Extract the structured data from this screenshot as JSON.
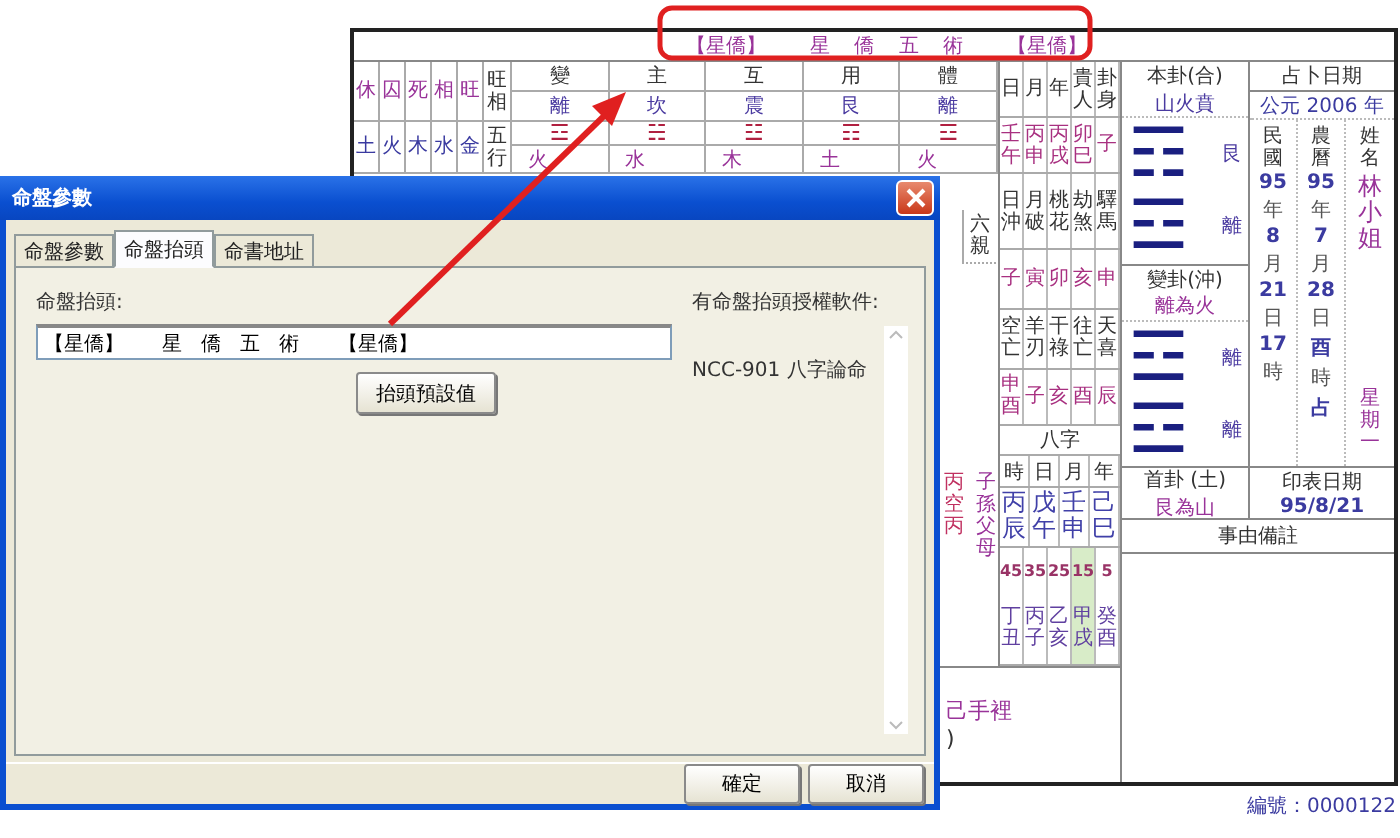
{
  "chart_header": {
    "left_tag": "【星僑】",
    "title": "星 僑 五 術",
    "right_tag": "【星僑】"
  },
  "seasonal": {
    "states": [
      "休",
      "囚",
      "死",
      "相",
      "旺"
    ],
    "state_label": "旺相",
    "elements": [
      "土",
      "火",
      "木",
      "水",
      "金"
    ],
    "element_label": "五行"
  },
  "trigrams": [
    {
      "role": "變",
      "name": "離",
      "symbol": "☲",
      "element": "火"
    },
    {
      "role": "主",
      "name": "坎",
      "symbol": "☵",
      "element": "水"
    },
    {
      "role": "互",
      "name": "震",
      "symbol": "☳",
      "element": "木"
    },
    {
      "role": "用",
      "name": "艮",
      "symbol": "☶",
      "element": "土"
    },
    {
      "role": "體",
      "name": "離",
      "symbol": "☲",
      "element": "火"
    }
  ],
  "relations_label": "六親",
  "line_fragments": {
    "stems": "丙空丙",
    "relations": "子孫父母"
  },
  "note_fragments": [
    "己手裡",
    ")"
  ],
  "day_pillars": [
    {
      "label": "日",
      "value": "壬午"
    },
    {
      "label": "月",
      "value": "丙申"
    },
    {
      "label": "年",
      "value": "丙戌"
    },
    {
      "label": "貴人",
      "value": "卯巳"
    },
    {
      "label": "卦身",
      "value": "子"
    }
  ],
  "clash": [
    {
      "label": "日沖",
      "value": "子"
    },
    {
      "label": "月破",
      "value": "寅"
    },
    {
      "label": "桃花",
      "value": "卯"
    },
    {
      "label": "劫煞",
      "value": "亥"
    },
    {
      "label": "驛馬",
      "value": "申"
    }
  ],
  "void": [
    {
      "label": "空亡",
      "value": "申酉"
    },
    {
      "label": "羊刃",
      "value": "子"
    },
    {
      "label": "干祿",
      "value": "亥"
    },
    {
      "label": "往亡",
      "value": "酉"
    },
    {
      "label": "天喜",
      "value": "辰"
    }
  ],
  "bazi": {
    "title": "八字",
    "columns": [
      {
        "label": "時",
        "value": "丙辰"
      },
      {
        "label": "日",
        "value": "戊午"
      },
      {
        "label": "月",
        "value": "壬申"
      },
      {
        "label": "年",
        "value": "己巳"
      }
    ]
  },
  "luck": [
    {
      "age": "45",
      "pillar": "丁丑",
      "current": false
    },
    {
      "age": "35",
      "pillar": "丙子",
      "current": false
    },
    {
      "age": "25",
      "pillar": "乙亥",
      "current": false
    },
    {
      "age": "15",
      "pillar": "甲戌",
      "current": true
    },
    {
      "age": "5",
      "pillar": "癸酉",
      "current": false
    }
  ],
  "main_hexagram": {
    "title": "本卦(合)",
    "name": "山火賁",
    "upper": {
      "name": "艮",
      "symbol": "☶"
    },
    "lower": {
      "name": "離",
      "symbol": "☲"
    }
  },
  "changed_hexagram": {
    "title": "變卦(沖)",
    "name": "離為火",
    "upper": {
      "name": "離",
      "symbol": "☲"
    },
    "lower": {
      "name": "離",
      "symbol": "☲"
    }
  },
  "head_hexagram": {
    "title": "首卦 (土)",
    "name": "艮為山"
  },
  "print_date": {
    "title": "印表日期",
    "value": "95/8/21"
  },
  "remarks": {
    "title": "事由備註"
  },
  "divination_date": {
    "title": "占卜日期",
    "era": "公元 2006 年",
    "columns": [
      {
        "label": "民國",
        "parts": [
          "95",
          "年",
          "8",
          "月",
          "21",
          "日",
          "17",
          "時"
        ]
      },
      {
        "label": "農曆",
        "parts": [
          "95",
          "年",
          "7",
          "月",
          "28",
          "日",
          "酉",
          "時",
          "占"
        ]
      }
    ],
    "name_label": "姓名",
    "name": "林小姐",
    "weekday": "星期一"
  },
  "serial": "編號：0000122",
  "dialog": {
    "title": "命盤參數",
    "tabs": [
      {
        "label": "命盤參數",
        "selected": false
      },
      {
        "label": "命盤抬頭",
        "selected": true
      },
      {
        "label": "命書地址",
        "selected": false
      }
    ],
    "field_label": "命盤抬頭:",
    "field_value": "【星僑】      星   僑   五   術      【星僑】",
    "default_button": "抬頭預設值",
    "list_label": "有命盤抬頭授權軟件:",
    "list_items": [
      "NCC-901 八字論命"
    ],
    "buttons": [
      "確定",
      "取消"
    ]
  }
}
